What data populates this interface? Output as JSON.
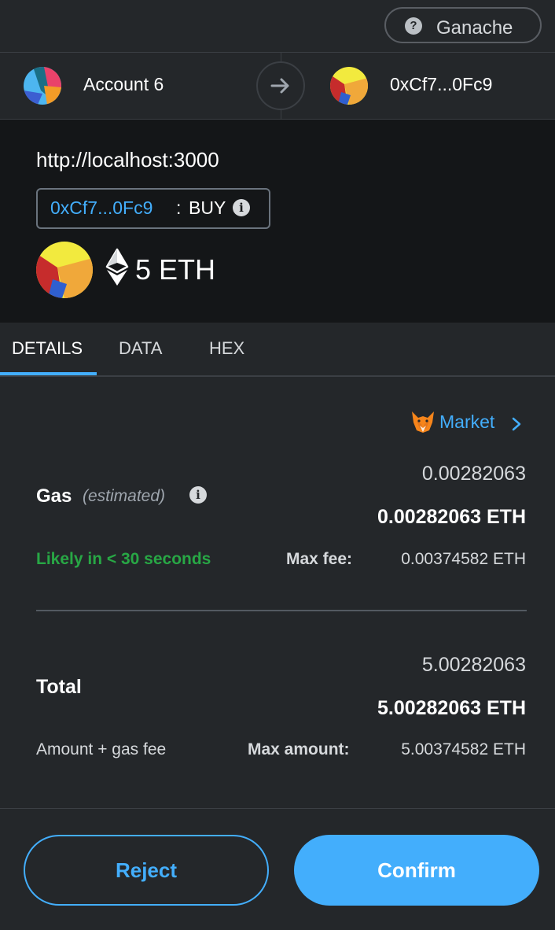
{
  "network": {
    "name": "Ganache",
    "help_icon": "question-icon"
  },
  "accounts": {
    "from_name": "Account 6",
    "to_name": "0xCf7...0Fc9",
    "arrow_icon": "arrow-right-icon"
  },
  "summary": {
    "origin": "http://localhost:3000",
    "method_address": "0xCf7...0Fc9",
    "method_separator": ":",
    "method_name": "BUY",
    "info_glyph": "i",
    "amount": "5 ETH",
    "eth_icon": "ethereum-icon"
  },
  "tabs": [
    {
      "label": "DETAILS",
      "active": true
    },
    {
      "label": "DATA",
      "active": false
    },
    {
      "label": "HEX",
      "active": false
    }
  ],
  "details": {
    "market_label": "Market",
    "market_icon": "fox-icon",
    "gas": {
      "title": "Gas",
      "subtitle": "(estimated)",
      "fiat_value": "0.00282063",
      "eth_value": "0.00282063 ETH",
      "likely": "Likely in < 30 seconds",
      "max_fee_label": "Max fee:",
      "max_fee_value": "0.00374582 ETH"
    },
    "total": {
      "title": "Total",
      "fiat_value": "5.00282063",
      "eth_value": "5.00282063 ETH",
      "subtitle": "Amount + gas fee",
      "max_amount_label": "Max amount:",
      "max_amount_value": "5.00374582 ETH"
    }
  },
  "footer": {
    "reject_label": "Reject",
    "confirm_label": "Confirm"
  },
  "colors": {
    "accent": "#43aefc",
    "success": "#28a745",
    "background": "#24272a",
    "summary_background": "#141618"
  }
}
